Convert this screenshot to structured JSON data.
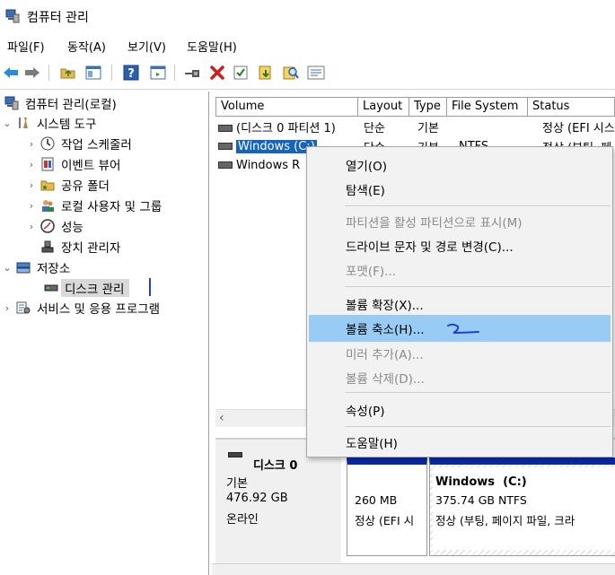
{
  "window": {
    "title": "컴퓨터 관리"
  },
  "menubar": {
    "items": [
      "파일(F)",
      "동작(A)",
      "보기(V)",
      "도움말(H)"
    ]
  },
  "toolbar": {
    "icons": [
      "back-arrow-icon",
      "forward-arrow-icon",
      "up-folder-icon",
      "console-tree-icon",
      "help-icon",
      "properties-icon",
      "connect-icon",
      "delete-icon",
      "check-icon",
      "import-icon",
      "search-icon",
      "list-icon"
    ]
  },
  "tree": {
    "root": "컴퓨터 관리(로컬)",
    "system_tools": "시스템 도구",
    "task_scheduler": "작업 스케줄러",
    "event_viewer": "이벤트 뷰어",
    "shared_folders": "공유 폴더",
    "local_users": "로컬 사용자 및 그룹",
    "performance": "성능",
    "device_manager": "장치 관리자",
    "storage": "저장소",
    "disk_management": "디스크 관리",
    "services": "서비스 및 응용 프로그램"
  },
  "volume_list": {
    "columns": [
      "Volume",
      "Layout",
      "Type",
      "File System",
      "Status"
    ],
    "rows": [
      {
        "volume": "(디스크 0 파티션 1)",
        "layout": "단순",
        "type": "기본",
        "fs": "",
        "status": "정상 (EFI 시스"
      },
      {
        "volume": "Windows (C:)",
        "layout": "단순",
        "type": "기본",
        "fs": "NTFS",
        "status": "정상 (부팅, 페"
      },
      {
        "volume": "Windows R",
        "layout": "",
        "type": "",
        "fs": "",
        "status": ""
      }
    ]
  },
  "disk_view": {
    "disk_name": "디스크 0",
    "disk_type": "기본",
    "disk_size": "476.92 GB",
    "disk_state": "온라인",
    "efi": {
      "size": "260 MB",
      "status": "정상 (EFI 시"
    },
    "windows": {
      "title": "Windows  (C:)",
      "size": "375.74 GB NTFS",
      "status": "정상 (부팅, 페이지 파일, 크라"
    }
  },
  "context_menu": {
    "open": "열기(O)",
    "explore": "탐색(E)",
    "mark_active": "파티션을 활성 파티션으로 표시(M)",
    "change_letter": "드라이브 문자 및 경로 변경(C)...",
    "format": "포맷(F)...",
    "extend": "볼륨 확장(X)...",
    "shrink": "볼륨 축소(H)...",
    "add_mirror": "미러 추가(A)...",
    "delete": "볼륨 삭제(D)...",
    "properties": "속성(P)",
    "help": "도움말(H)"
  },
  "colors": {
    "selection": "#1565c0",
    "menu_hover": "#99ccf5",
    "partition_bar": "#0a2aa8",
    "annotation": "#1f3fd6"
  }
}
